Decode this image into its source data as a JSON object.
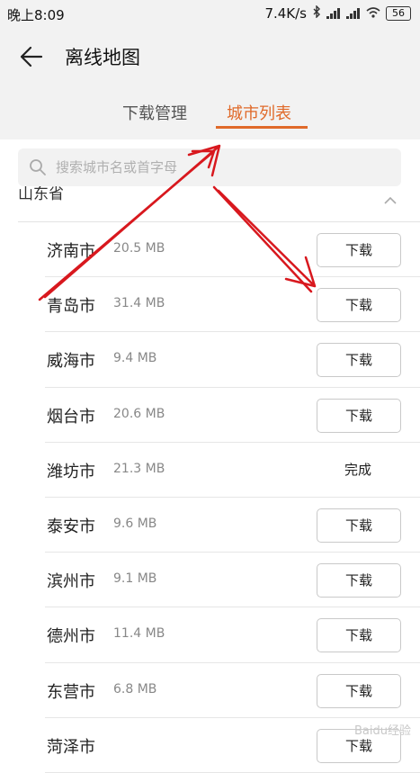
{
  "status_bar": {
    "time": "晚上8:09",
    "network_speed": "7.4K/s",
    "battery": "56"
  },
  "header": {
    "title": "离线地图",
    "tabs": [
      {
        "label": "下载管理",
        "active": false
      },
      {
        "label": "城市列表",
        "active": true
      }
    ]
  },
  "search": {
    "placeholder": "搜索城市名或首字母"
  },
  "province": {
    "name": "山东省"
  },
  "cities": [
    {
      "name": "济南市",
      "size": "20.5 MB",
      "action": "下载"
    },
    {
      "name": "青岛市",
      "size": "31.4 MB",
      "action": "下载"
    },
    {
      "name": "威海市",
      "size": "9.4 MB",
      "action": "下载"
    },
    {
      "name": "烟台市",
      "size": "20.6 MB",
      "action": "下载"
    },
    {
      "name": "潍坊市",
      "size": "21.3 MB",
      "action": "完成"
    },
    {
      "name": "泰安市",
      "size": "9.6 MB",
      "action": "下载"
    },
    {
      "name": "滨州市",
      "size": "9.1 MB",
      "action": "下载"
    },
    {
      "name": "德州市",
      "size": "11.4 MB",
      "action": "下载"
    },
    {
      "name": "东营市",
      "size": "6.8 MB",
      "action": "下载"
    },
    {
      "name": "菏泽市",
      "size": "",
      "action": "下载"
    }
  ],
  "colors": {
    "accent": "#e06a2a",
    "header_bg": "#f2f2f2",
    "annotation_arrow": "#d8181e"
  },
  "icons": {
    "back": "back-arrow-icon",
    "search": "search-icon",
    "collapse": "chevron-up-icon"
  },
  "watermark": "Baidu经验"
}
